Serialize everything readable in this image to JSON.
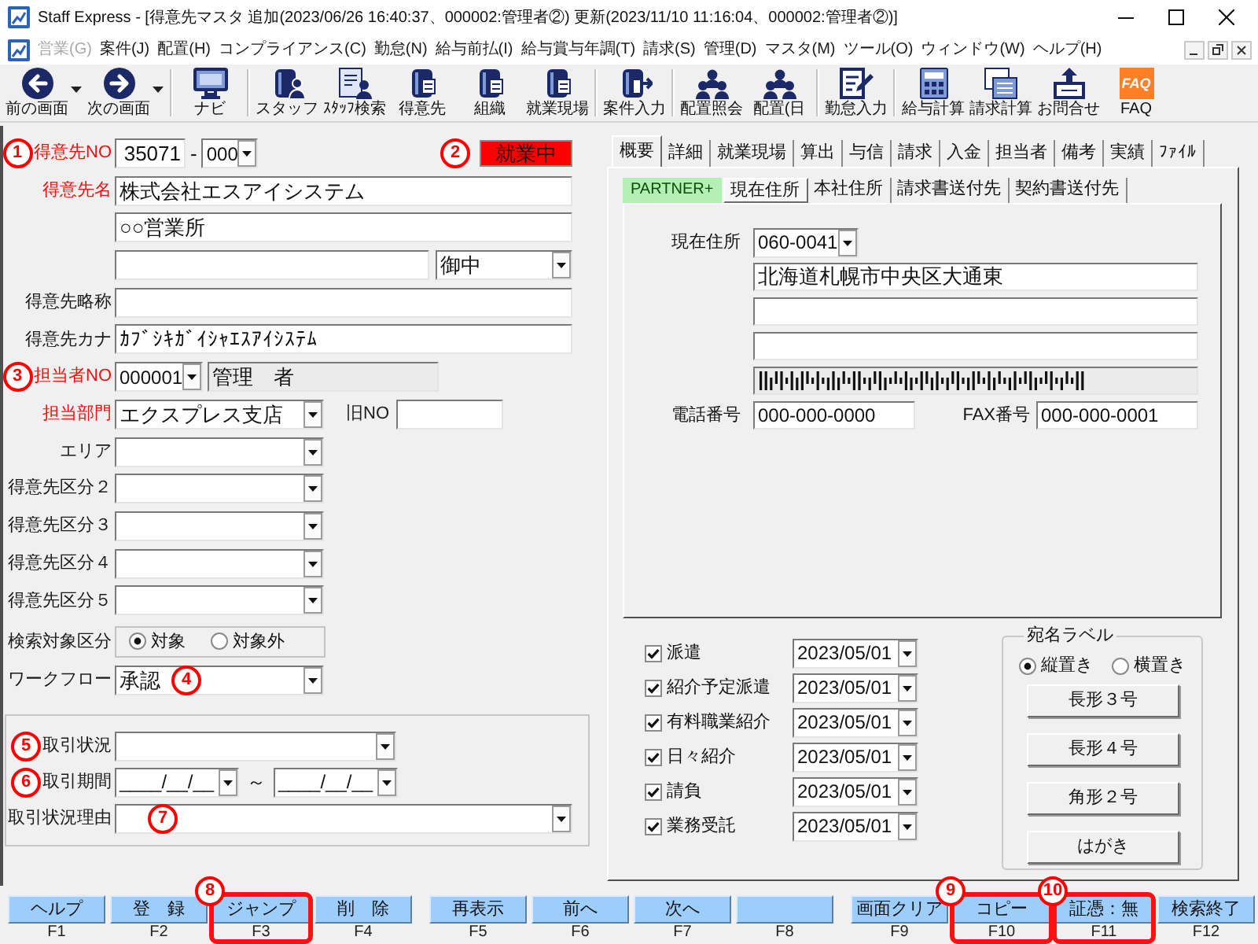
{
  "window": {
    "title": "Staff Express - [得意先マスタ 追加(2023/06/26 16:40:37、000002:管理者②) 更新(2023/11/10 11:16:04、000002:管理者②)]"
  },
  "menu_bar": [
    {
      "label": "営業(G)",
      "disabled": true
    },
    {
      "label": "案件(J)",
      "disabled": false
    },
    {
      "label": "配置(H)",
      "disabled": false
    },
    {
      "label": "コンプライアンス(C)",
      "disabled": false
    },
    {
      "label": "勤怠(N)",
      "disabled": false
    },
    {
      "label": "給与前払(I)",
      "disabled": false
    },
    {
      "label": "給与賞与年調(T)",
      "disabled": false
    },
    {
      "label": "請求(S)",
      "disabled": false
    },
    {
      "label": "管理(D)",
      "disabled": false
    },
    {
      "label": "マスタ(M)",
      "disabled": false
    },
    {
      "label": "ツール(O)",
      "disabled": false
    },
    {
      "label": "ウィンドウ(W)",
      "disabled": false
    },
    {
      "label": "ヘルプ(H)",
      "disabled": false
    }
  ],
  "toolbar": [
    {
      "buttons": [
        {
          "label": "前の画面",
          "kind": "back",
          "dropdown": true
        },
        {
          "label": "次の画面",
          "kind": "forward",
          "dropdown": true
        }
      ]
    },
    {
      "buttons": [
        {
          "label": "ナビ",
          "kind": "monitor",
          "dropdown": false
        }
      ]
    },
    {
      "buttons": [
        {
          "label": "スタッフ",
          "kind": "binderperson",
          "dropdown": false
        },
        {
          "label": "ｽﾀｯﾌ検索",
          "kind": "docperson",
          "dropdown": false
        },
        {
          "label": "得意先",
          "kind": "binder",
          "dropdown": false
        },
        {
          "label": "組織",
          "kind": "binder",
          "dropdown": false
        },
        {
          "label": "就業現場",
          "kind": "binder",
          "dropdown": false
        }
      ]
    },
    {
      "buttons": [
        {
          "label": "案件入力",
          "kind": "binderarrow",
          "dropdown": false
        }
      ]
    },
    {
      "buttons": [
        {
          "label": "配置照会",
          "kind": "people",
          "dropdown": false
        },
        {
          "label": "配置(日",
          "kind": "people",
          "dropdown": false
        }
      ]
    },
    {
      "buttons": [
        {
          "label": "勤怠入力",
          "kind": "pencil",
          "dropdown": false
        }
      ]
    },
    {
      "buttons": [
        {
          "label": "給与計算",
          "kind": "calculator",
          "dropdown": false
        },
        {
          "label": "請求計算",
          "kind": "sheet",
          "dropdown": false
        },
        {
          "label": "お問合せ",
          "kind": "tray",
          "dropdown": false
        },
        {
          "label": "FAQ",
          "kind": "faq",
          "dropdown": false,
          "logo": "FAQ"
        }
      ]
    }
  ],
  "customer_form": {
    "status": {
      "text": "就業中",
      "badge": "2"
    },
    "rows": [
      {
        "kind": "number",
        "label": "得意先NO",
        "required": true,
        "badge": "1",
        "value": "35071",
        "separator": "-",
        "branch": "000"
      },
      {
        "kind": "text",
        "label": "得意先名",
        "required": true,
        "value": "株式会社エスアイシステム"
      },
      {
        "kind": "text",
        "value": "○○営業所"
      },
      {
        "kind": "textselect",
        "select": "御中"
      },
      {
        "kind": "text",
        "label": "得意先略称",
        "required": false
      },
      {
        "kind": "text",
        "label": "得意先カナ",
        "required": false,
        "value": "ｶﾌﾞｼｷｶﾞｲｼｬｴｽｱｲｼｽﾃﾑ"
      },
      {
        "kind": "staff",
        "label": "担当者NO",
        "required": true,
        "badge": "3",
        "code": "000001",
        "name": "管理　者"
      },
      {
        "kind": "department",
        "label": "担当部門",
        "required": true,
        "value": "エクスプレス支店",
        "old_no_label": "旧NO"
      },
      {
        "kind": "select",
        "label": "エリア",
        "required": false
      },
      {
        "kind": "select",
        "label": "得意先区分２",
        "required": false
      },
      {
        "kind": "select",
        "label": "得意先区分３",
        "required": false
      },
      {
        "kind": "select",
        "label": "得意先区分４",
        "required": false
      },
      {
        "kind": "select",
        "label": "得意先区分５",
        "required": false
      },
      {
        "kind": "radio",
        "label": "検索対象区分",
        "required": false,
        "options": [
          {
            "label": "対象",
            "selected": true
          },
          {
            "label": "対象外",
            "selected": false
          }
        ]
      },
      {
        "kind": "select",
        "label": "ワークフロー",
        "required": false,
        "value": "承認",
        "field_badge": "4"
      }
    ]
  },
  "transaction_group": {
    "rows": [
      {
        "kind": "wideselect",
        "label": "取引状況",
        "required": false,
        "badge": "5"
      },
      {
        "kind": "daterange",
        "label": "取引期間",
        "required": false,
        "badge": "6",
        "from": "____/__/__",
        "separator": "～",
        "to": "____/__/__"
      },
      {
        "kind": "fullselect",
        "label": "取引状況理由",
        "required": false,
        "field_badge": "7"
      }
    ]
  },
  "detail_tabs": [
    {
      "label": "概要",
      "selected": true
    },
    {
      "label": "詳細",
      "selected": false
    },
    {
      "label": "就業現場",
      "selected": false
    },
    {
      "label": "算出",
      "selected": false
    },
    {
      "label": "与信",
      "selected": false
    },
    {
      "label": "請求",
      "selected": false
    },
    {
      "label": "入金",
      "selected": false
    },
    {
      "label": "担当者",
      "selected": false
    },
    {
      "label": "備考",
      "selected": false
    },
    {
      "label": "実績",
      "selected": false
    },
    {
      "label": "ﾌｧｲﾙ",
      "selected": false
    }
  ],
  "address_panel": {
    "tag": "PARTNER+",
    "tabs": [
      {
        "label": "現在住所",
        "selected": true
      },
      {
        "label": "本社住所",
        "selected": false
      },
      {
        "label": "請求書送付先",
        "selected": false
      },
      {
        "label": "契約書送付先",
        "selected": false
      }
    ],
    "address_label": "現在住所",
    "postal_code": "060-0041",
    "address_fields": [
      {
        "kind": "text",
        "value": "北海道札幌市中央区大通東"
      },
      {
        "kind": "text"
      },
      {
        "kind": "text"
      },
      {
        "kind": "barcode"
      }
    ],
    "phone": {
      "label": "電話番号",
      "value": "000-000-0000"
    },
    "fax": {
      "label": "FAX番号",
      "value": "000-000-0001"
    }
  },
  "contract_types": [
    {
      "label": "派遣",
      "checked": true,
      "date": "2023/05/01"
    },
    {
      "label": "紹介予定派遣",
      "checked": true,
      "date": "2023/05/01"
    },
    {
      "label": "有料職業紹介",
      "checked": true,
      "date": "2023/05/01"
    },
    {
      "label": "日々紹介",
      "checked": true,
      "date": "2023/05/01"
    },
    {
      "label": "請負",
      "checked": true,
      "date": "2023/05/01"
    },
    {
      "label": "業務受託",
      "checked": true,
      "date": "2023/05/01"
    }
  ],
  "address_label_box": {
    "title": "宛名ラベル",
    "orientation": [
      {
        "label": "縦置き",
        "selected": true
      },
      {
        "label": "横置き",
        "selected": false
      }
    ],
    "buttons": [
      "長形３号",
      "長形４号",
      "角形２号",
      "はがき"
    ]
  },
  "function_keys": [
    {
      "label": "ヘルプ",
      "key": "F1",
      "highlighted": false
    },
    {
      "label": "登　録",
      "key": "F2",
      "highlighted": false
    },
    {
      "label": "ジャンプ",
      "key": "F3",
      "highlighted": true,
      "badge": "8"
    },
    {
      "label": "削　除",
      "key": "F4",
      "highlighted": false
    },
    {
      "label": "再表示",
      "key": "F5",
      "highlighted": false
    },
    {
      "label": "前へ",
      "key": "F6",
      "highlighted": false
    },
    {
      "label": "次へ",
      "key": "F7",
      "highlighted": false
    },
    {
      "key": "F8",
      "highlighted": false
    },
    {
      "label": "画面クリア",
      "key": "F9",
      "highlighted": false
    },
    {
      "label": "コピー",
      "key": "F10",
      "highlighted": true,
      "badge": "9"
    },
    {
      "label": "証憑：無",
      "key": "F11",
      "highlighted": true,
      "badge": "10"
    },
    {
      "label": "検索終了",
      "key": "F12",
      "highlighted": false
    }
  ]
}
